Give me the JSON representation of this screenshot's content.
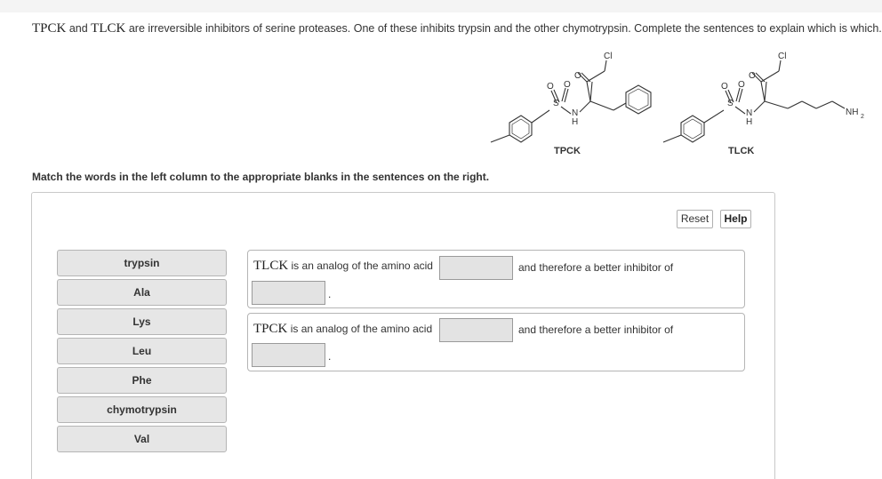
{
  "question": {
    "abbr_1": "TPCK",
    "and": "and",
    "abbr_2": "TLCK",
    "text": "are irreversible inhibitors of serine proteases. One of these inhibits trypsin and the other chymotrypsin. Complete the sentences to explain which is which."
  },
  "structures": {
    "tpck": {
      "name": "TPCK",
      "cl": "Cl",
      "o": "O",
      "s": "S",
      "n": "N",
      "h": "H"
    },
    "tlck": {
      "name": "TLCK",
      "cl": "Cl",
      "o": "O",
      "s": "S",
      "n": "N",
      "h": "H",
      "nh": "NH",
      "sub2": "2"
    }
  },
  "instruction": "Match the words in the left column to the appropriate blanks in the sentences on the right.",
  "buttons": {
    "reset": "Reset",
    "help": "Help"
  },
  "word_bank": [
    "trypsin",
    "Ala",
    "Lys",
    "Leu",
    "Phe",
    "chymotrypsin",
    "Val"
  ],
  "sentences": [
    {
      "abbr": "TLCK",
      "text1": "is an analog of the amino acid",
      "text2": "and therefore a better inhibitor of",
      "period": "."
    },
    {
      "abbr": "TPCK",
      "text1": "is an analog of the amino acid",
      "text2": "and therefore a better inhibitor of",
      "period": "."
    }
  ]
}
